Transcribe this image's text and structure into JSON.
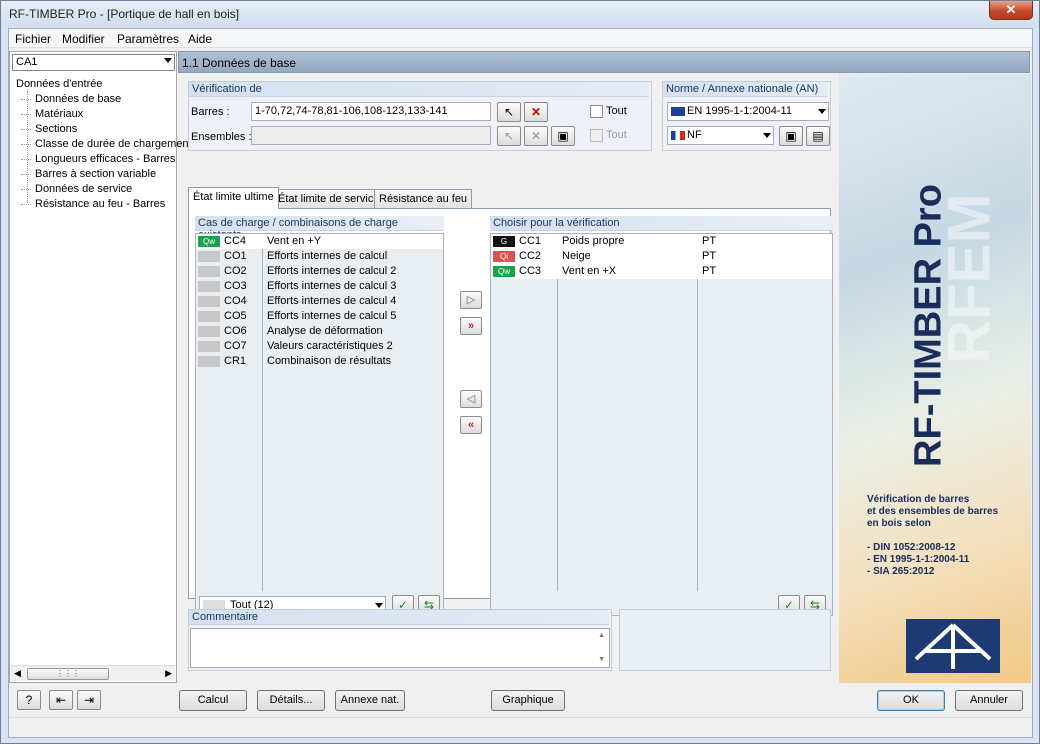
{
  "window": {
    "title": "RF-TIMBER Pro - [Portique de hall en bois]",
    "close": "✕"
  },
  "menu": [
    "Fichier",
    "Modifier",
    "Paramètres",
    "Aide"
  ],
  "case": {
    "selected": "CA1"
  },
  "tree": {
    "root": "Données d'entrée",
    "items": [
      "Données de base",
      "Matériaux",
      "Sections",
      "Classe de durée de chargement",
      "Longueurs efficaces - Barres",
      "Barres à section variable",
      "Données de service",
      "Résistance au feu - Barres"
    ]
  },
  "section_title": "1.1 Données de base",
  "verification": {
    "header": "Vérification de",
    "members_label": "Barres :",
    "members_value": "1-70,72,74-78,81-106,108-123,133-141",
    "sets_label": "Ensembles :",
    "sets_value": "",
    "all_label": "Tout",
    "all_sets_label": "Tout"
  },
  "norm": {
    "header": "Norme / Annexe nationale (AN)",
    "standard": "EN 1995-1-1:2004-11",
    "annex": "NF"
  },
  "tabs": [
    "État limite ultime",
    "État limite de service",
    "Résistance au feu"
  ],
  "existing": {
    "header": "Cas de charge / combinaisons de charge existants",
    "rows": [
      {
        "badge": "Qw",
        "color": "#1aa34a",
        "id": "CC4",
        "desc": "Vent en +Y"
      },
      {
        "badge": "",
        "color": "#c8c8c8",
        "id": "CO1",
        "desc": "Efforts internes de calcul"
      },
      {
        "badge": "",
        "color": "#c8c8c8",
        "id": "CO2",
        "desc": "Efforts internes de calcul 2"
      },
      {
        "badge": "",
        "color": "#c8c8c8",
        "id": "CO3",
        "desc": "Efforts internes de calcul 3"
      },
      {
        "badge": "",
        "color": "#c8c8c8",
        "id": "CO4",
        "desc": "Efforts internes de calcul 4"
      },
      {
        "badge": "",
        "color": "#c8c8c8",
        "id": "CO5",
        "desc": "Efforts internes de calcul 5"
      },
      {
        "badge": "",
        "color": "#c8c8c8",
        "id": "CO6",
        "desc": "Analyse de déformation"
      },
      {
        "badge": "",
        "color": "#c8c8c8",
        "id": "CO7",
        "desc": "Valeurs caractéristiques 2"
      },
      {
        "badge": "",
        "color": "#c8c8c8",
        "id": "CR1",
        "desc": "Combinaison de résultats"
      }
    ],
    "filter": "Tout (12)"
  },
  "selected": {
    "header": "Choisir pour la vérification",
    "rows": [
      {
        "badge": "G",
        "color": "#111111",
        "id": "CC1",
        "desc": "Poids propre",
        "type": "PT"
      },
      {
        "badge": "Qi",
        "color": "#d9534f",
        "id": "CC2",
        "desc": "Neige",
        "type": "PT"
      },
      {
        "badge": "Qw",
        "color": "#1aa34a",
        "id": "CC3",
        "desc": "Vent en +X",
        "type": "PT"
      }
    ]
  },
  "comment": {
    "header": "Commentaire",
    "value": ""
  },
  "banner": {
    "title": "RF-TIMBER Pro",
    "bg_text": "RFEM",
    "lines": [
      "Vérification de barres",
      "et des ensembles de barres",
      "en bois selon",
      "",
      "- DIN 1052:2008-12",
      "- EN 1995-1-1:2004-11",
      "- SIA 265:2012"
    ]
  },
  "buttons": {
    "calc": "Calcul",
    "details": "Détails...",
    "annex": "Annexe nat. ...",
    "graphics": "Graphique",
    "ok": "OK",
    "cancel": "Annuler"
  }
}
